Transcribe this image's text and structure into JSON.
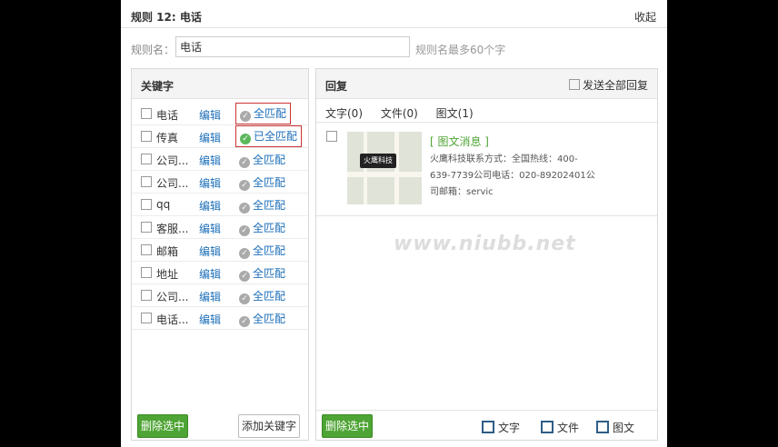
{
  "rule": {
    "title": "规则 12: 电话",
    "collapse": "收起"
  },
  "rule_name": {
    "label": "规则名：",
    "value": "电话",
    "hint": "规则名最多60个字"
  },
  "keywords": {
    "title": "关键字",
    "edit_label": "编辑",
    "items": [
      {
        "keyword": "电话",
        "match": "全匹配",
        "active": false
      },
      {
        "keyword": "传真",
        "match": "已全匹配",
        "active": true
      },
      {
        "keyword": "公司...",
        "match": "全匹配",
        "active": false
      },
      {
        "keyword": "公司...",
        "match": "全匹配",
        "active": false
      },
      {
        "keyword": "qq",
        "match": "全匹配",
        "active": false
      },
      {
        "keyword": "客服...",
        "match": "全匹配",
        "active": false
      },
      {
        "keyword": "邮箱",
        "match": "全匹配",
        "active": false
      },
      {
        "keyword": "地址",
        "match": "全匹配",
        "active": false
      },
      {
        "keyword": "公司...",
        "match": "全匹配",
        "active": false
      },
      {
        "keyword": "电话...",
        "match": "全匹配",
        "active": false
      }
    ],
    "delete_selected": "删除选中",
    "add_keyword": "添加关键字"
  },
  "reply": {
    "title": "回复",
    "send_all": "发送全部回复",
    "tabs": [
      "文字(0)",
      "文件(0)",
      "图文(1)"
    ],
    "item": {
      "title": "[ 图文消息 ]",
      "map_label": "火鹰科技",
      "desc": "火鹰科技联系方式：全国热线：400-639-7739公司电话：020-89202401公司邮箱：servic"
    },
    "watermark": "www.niubb.net",
    "delete_selected": "删除选中",
    "tools": [
      {
        "label": "文字",
        "icon": "edit-text-icon"
      },
      {
        "label": "文件",
        "icon": "file-icon"
      },
      {
        "label": "图文",
        "icon": "image-text-icon"
      }
    ]
  }
}
